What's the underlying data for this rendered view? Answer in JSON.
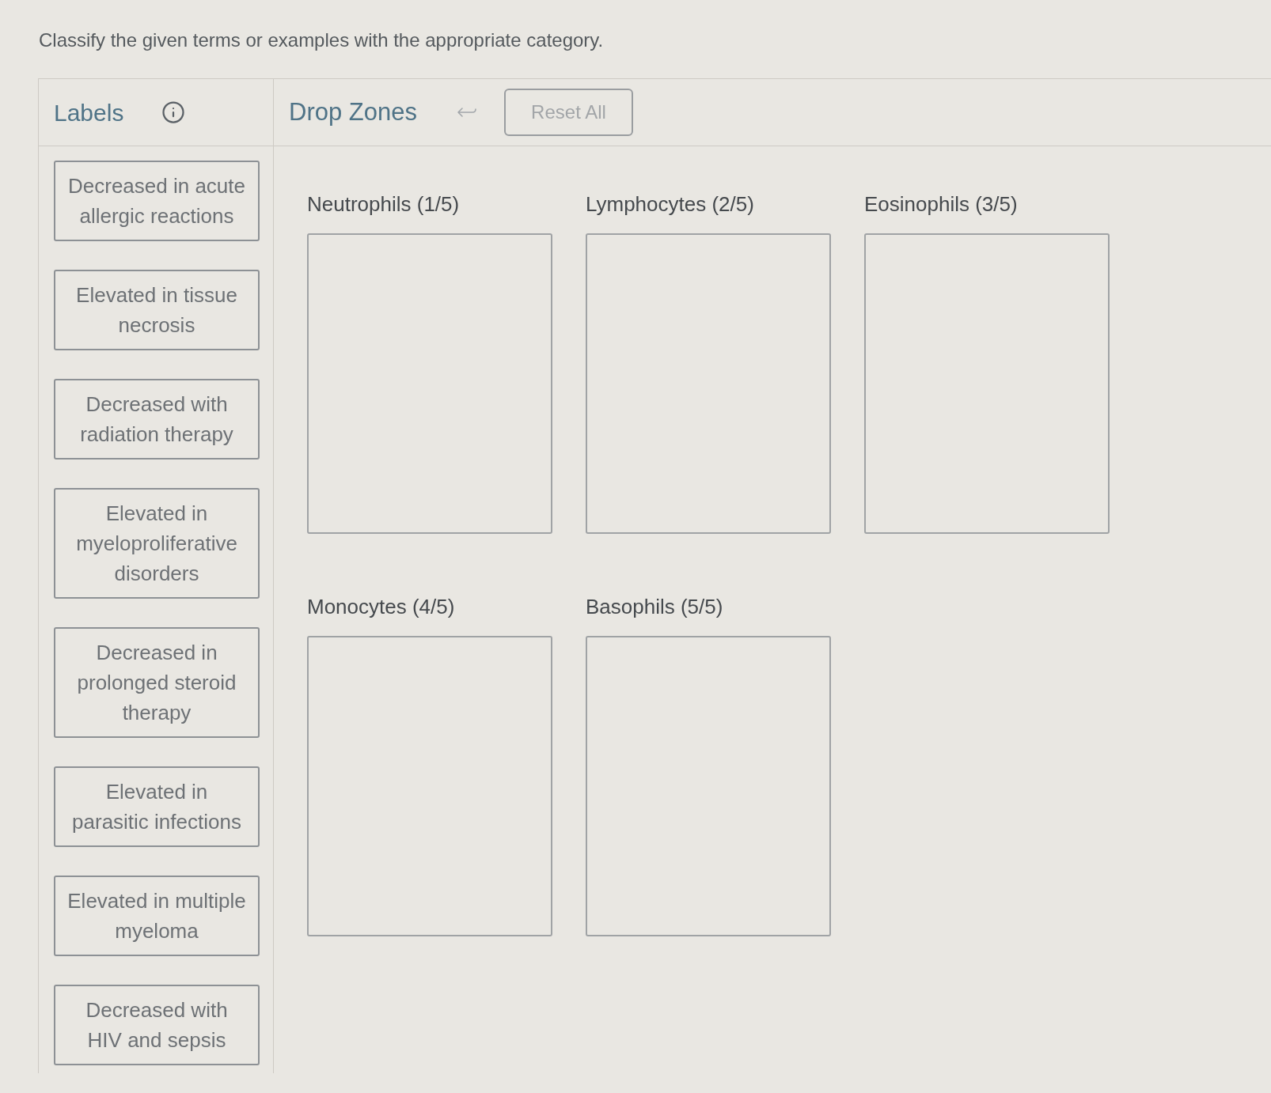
{
  "instruction": "Classify the given terms or examples with the appropriate category.",
  "labels_panel": {
    "title": "Labels",
    "cards": [
      "Decreased in acute allergic reactions",
      "Elevated in tissue necrosis",
      "Decreased with radiation therapy",
      "Elevated in myeloproliferative disorders",
      "Decreased in prolonged steroid therapy",
      "Elevated in parasitic infections",
      "Elevated in multiple myeloma",
      "Decreased with HIV and sepsis"
    ]
  },
  "drop_zones_panel": {
    "title": "Drop Zones",
    "reset_button": {
      "label": "Reset All",
      "disabled": true
    },
    "zones": [
      {
        "title": "Neutrophils (1/5)"
      },
      {
        "title": "Lymphocytes (2/5)"
      },
      {
        "title": "Eosinophils (3/5)"
      },
      {
        "title": "Monocytes (4/5)"
      },
      {
        "title": "Basophils (5/5)"
      }
    ]
  }
}
